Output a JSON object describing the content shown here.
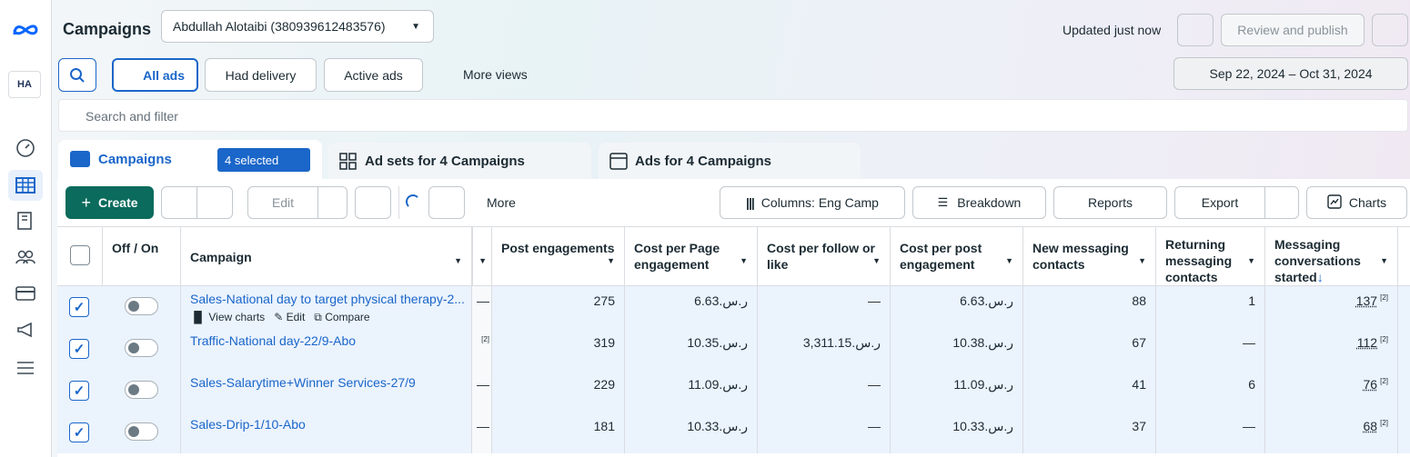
{
  "header": {
    "title": "Campaigns",
    "account": "Abdullah Alotaibi (380939612483576)",
    "updated": "Updated just now",
    "review": "Review and publish"
  },
  "filters": {
    "all_ads": "All ads",
    "had_delivery": "Had delivery",
    "active_ads": "Active ads",
    "more_views": "More views",
    "date_range": "Sep 22, 2024 – Oct 31, 2024",
    "search_placeholder": "Search and filter"
  },
  "tabs": {
    "campaigns": "Campaigns",
    "selected": "4 selected",
    "adsets": "Ad sets for 4 Campaigns",
    "ads": "Ads for 4 Campaigns"
  },
  "toolbar": {
    "create": "Create",
    "edit": "Edit",
    "more": "More",
    "columns": "Columns: Eng Camp",
    "breakdown": "Breakdown",
    "reports": "Reports",
    "export": "Export",
    "charts": "Charts"
  },
  "columns": {
    "offon": "Off / On",
    "campaign": "Campaign",
    "post_eng": "Post engagements",
    "cpp_eng": "Cost per Page engagement",
    "cp_follow": "Cost per follow or like",
    "cp_post_eng": "Cost per post engagement",
    "new_msg": "New messaging contacts",
    "ret_msg": "Returning messaging contacts",
    "msg_conv": "Messaging conversations started"
  },
  "row_actions": {
    "view_charts": "View charts",
    "edit": "Edit",
    "compare": "Compare"
  },
  "rows": [
    {
      "name": "Sales-National day to target physical therapy-2...",
      "pre": "—",
      "post_eng": "275",
      "cpp_eng": "6.63.ر.س",
      "cp_follow": "—",
      "cp_post_eng": "6.63.ر.س",
      "new_msg": "88",
      "ret_msg": "1",
      "msg_conv": "137",
      "sup": "[2]"
    },
    {
      "name": "Traffic-National day-22/9-Abo",
      "pre": "[2]",
      "post_eng": "319",
      "cpp_eng": "10.35.ر.س",
      "cp_follow": "3,311.15.ر.س",
      "cp_post_eng": "10.38.ر.س",
      "new_msg": "67",
      "ret_msg": "—",
      "msg_conv": "112",
      "sup": "[2]"
    },
    {
      "name": "Sales-Salarytime+Winner Services-27/9",
      "pre": "—",
      "post_eng": "229",
      "cpp_eng": "11.09.ر.س",
      "cp_follow": "—",
      "cp_post_eng": "11.09.ر.س",
      "new_msg": "41",
      "ret_msg": "6",
      "msg_conv": "76",
      "sup": "[2]"
    },
    {
      "name": "Sales-Drip-1/10-Abo",
      "pre": "—",
      "post_eng": "181",
      "cpp_eng": "10.33.ر.س",
      "cp_follow": "—",
      "cp_post_eng": "10.33.ر.س",
      "new_msg": "37",
      "ret_msg": "—",
      "msg_conv": "68",
      "sup": "[2]"
    }
  ],
  "brand": {
    "accent": "#1a66c9",
    "create_bg": "#0b6b5c"
  }
}
